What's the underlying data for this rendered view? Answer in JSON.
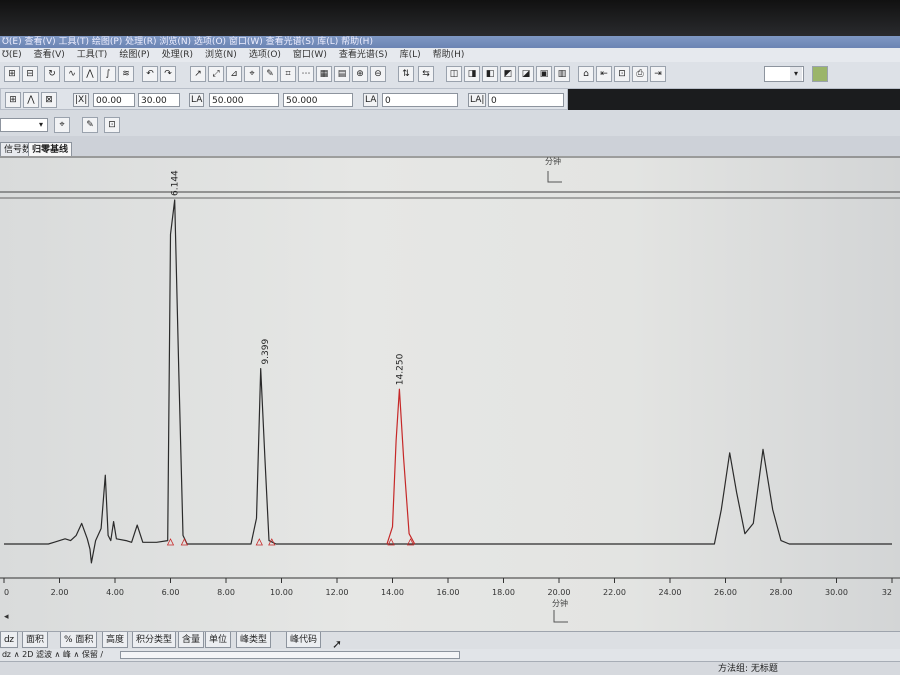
{
  "app": {
    "title": "Ʊ(E) 查看(V) 工具(T) 绘图(P) 处理(R) 浏览(N) 选项(O) 窗口(W) 查看光谱(S) 库(L) 帮助(H)"
  },
  "menu": {
    "items": [
      "Ʊ(E)",
      "查看(V)",
      "工具(T)",
      "绘图(P)",
      "处理(R)",
      "浏览(N)",
      "选项(O)",
      "窗口(W)",
      "查看光谱(S)",
      "库(L)",
      "帮助(H)"
    ]
  },
  "toolbar2": {
    "range_x_from": "00.00",
    "range_x_to": "30.00",
    "range_y_from": "50.000",
    "range_y_to": "50.000",
    "threshold_1": "0",
    "threshold_2": "0"
  },
  "tabs": {
    "items": [
      "信号数",
      "归零基线"
    ]
  },
  "top_axis": {
    "unit_label": "分钟"
  },
  "chart_data": {
    "type": "line",
    "xlabel": "分钟",
    "xlim": [
      0,
      32
    ],
    "x_ticks": [
      "0",
      "2.00",
      "4.00",
      "6.00",
      "8.00",
      "10.00",
      "12.00",
      "14.00",
      "16.00",
      "18.00",
      "20.00",
      "22.00",
      "24.00",
      "26.00",
      "28.00",
      "30.00",
      "32"
    ],
    "grid": false,
    "series": [
      {
        "color": "#2b2b2b",
        "points": [
          [
            0,
            0
          ],
          [
            1.6,
            0
          ],
          [
            1.8,
            0.01
          ],
          [
            2.2,
            0.03
          ],
          [
            2.4,
            0.02
          ],
          [
            2.6,
            0.05
          ],
          [
            2.8,
            0.12
          ],
          [
            3.0,
            0.03
          ],
          [
            3.1,
            -0.03
          ],
          [
            3.15,
            -0.11
          ],
          [
            3.3,
            0.02
          ],
          [
            3.5,
            0.09
          ],
          [
            3.65,
            0.4
          ],
          [
            3.75,
            0.05
          ],
          [
            3.85,
            0.02
          ],
          [
            3.95,
            0.13
          ],
          [
            4.05,
            0.03
          ],
          [
            4.4,
            0.02
          ],
          [
            4.6,
            0.01
          ],
          [
            4.8,
            0.11
          ],
          [
            5.0,
            0.01
          ],
          [
            5.5,
            0.01
          ],
          [
            5.9,
            0.02
          ],
          [
            6.0,
            1.8
          ],
          [
            6.15,
            2.0
          ],
          [
            6.3,
            1.0
          ],
          [
            6.45,
            0.05
          ],
          [
            6.6,
            0
          ],
          [
            8.9,
            0
          ],
          [
            9.1,
            0.15
          ],
          [
            9.25,
            1.02
          ],
          [
            9.4,
            0.5
          ],
          [
            9.55,
            0.02
          ],
          [
            9.8,
            0
          ],
          [
            25.6,
            0
          ],
          [
            25.85,
            0.2
          ],
          [
            26.15,
            0.53
          ],
          [
            26.4,
            0.3
          ],
          [
            26.7,
            0.06
          ],
          [
            27.0,
            0.12
          ],
          [
            27.35,
            0.55
          ],
          [
            27.7,
            0.2
          ],
          [
            28.0,
            0.02
          ],
          [
            28.3,
            0
          ],
          [
            32,
            0
          ]
        ]
      },
      {
        "color": "#c62828",
        "points": [
          [
            13.8,
            0
          ],
          [
            14.0,
            0.1
          ],
          [
            14.13,
            0.6
          ],
          [
            14.25,
            0.9
          ],
          [
            14.4,
            0.5
          ],
          [
            14.6,
            0.06
          ],
          [
            14.8,
            0
          ]
        ]
      }
    ],
    "peaks": [
      {
        "rt": 6.144,
        "label": "6.144"
      },
      {
        "rt": 9.399,
        "label": "9.399"
      },
      {
        "rt": 14.25,
        "label": "14.250"
      }
    ]
  },
  "bottom_tabs": {
    "items": [
      "ǳ",
      "面积",
      "% 面积",
      "高度",
      "积分类型",
      "含量",
      "单位",
      "峰类型",
      "峰代码"
    ]
  },
  "status_row": {
    "text": "ǳ ∧ 2D 滤波 ∧ 峰 ∧ 保留 /"
  },
  "status": {
    "method_text": "方法组: 无标题"
  }
}
